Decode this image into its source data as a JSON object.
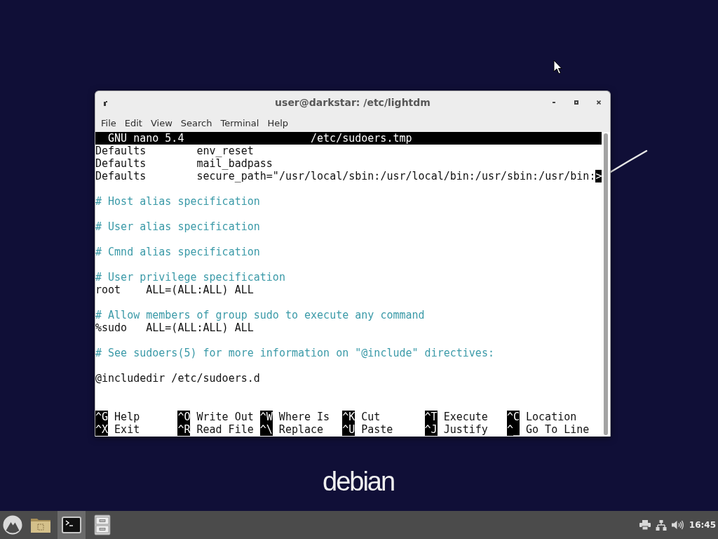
{
  "window": {
    "title": "user@darkstar: /etc/lightdm",
    "menu": [
      "File",
      "Edit",
      "View",
      "Search",
      "Terminal",
      "Help"
    ]
  },
  "editor": {
    "version": "GNU nano 5.4",
    "file": "/etc/sudoers.tmp",
    "lines": [
      {
        "kind": "text",
        "text": "Defaults        env_reset"
      },
      {
        "kind": "text",
        "text": "Defaults        mail_badpass"
      },
      {
        "kind": "text",
        "text": "Defaults        secure_path=\"/usr/local/sbin:/usr/local/bin:/usr/sbin:/usr/bin:",
        "overflow_marker": ">"
      },
      {
        "kind": "blank"
      },
      {
        "kind": "comment",
        "text": "# Host alias specification"
      },
      {
        "kind": "blank"
      },
      {
        "kind": "comment",
        "text": "# User alias specification"
      },
      {
        "kind": "blank"
      },
      {
        "kind": "comment",
        "text": "# Cmnd alias specification"
      },
      {
        "kind": "blank"
      },
      {
        "kind": "comment",
        "text": "# User privilege specification"
      },
      {
        "kind": "text",
        "text": "root    ALL=(ALL:ALL) ALL"
      },
      {
        "kind": "blank"
      },
      {
        "kind": "comment",
        "text": "# Allow members of group sudo to execute any command"
      },
      {
        "kind": "text",
        "text": "%sudo   ALL=(ALL:ALL) ALL"
      },
      {
        "kind": "blank"
      },
      {
        "kind": "comment",
        "text": "# See sudoers(5) for more information on \"@include\" directives:"
      },
      {
        "kind": "blank"
      },
      {
        "kind": "text",
        "text": "@includedir /etc/sudoers.d"
      }
    ],
    "shortcuts": [
      {
        "key": "^G",
        "label": "Help"
      },
      {
        "key": "^O",
        "label": "Write Out"
      },
      {
        "key": "^W",
        "label": "Where Is"
      },
      {
        "key": "^K",
        "label": "Cut"
      },
      {
        "key": "^T",
        "label": "Execute"
      },
      {
        "key": "^C",
        "label": "Location"
      },
      {
        "key": "^X",
        "label": "Exit"
      },
      {
        "key": "^R",
        "label": "Read File"
      },
      {
        "key": "^\\",
        "label": "Replace"
      },
      {
        "key": "^U",
        "label": "Paste"
      },
      {
        "key": "^J",
        "label": "Justify"
      },
      {
        "key": "^_",
        "label": "Go To Line"
      }
    ]
  },
  "desktop": {
    "logo": "debian"
  },
  "taskbar": {
    "launchers": [
      {
        "kind": "folder",
        "active": false
      },
      {
        "kind": "terminal",
        "active": true
      },
      {
        "kind": "cabinet",
        "active": false
      }
    ],
    "clock": "16:45"
  }
}
